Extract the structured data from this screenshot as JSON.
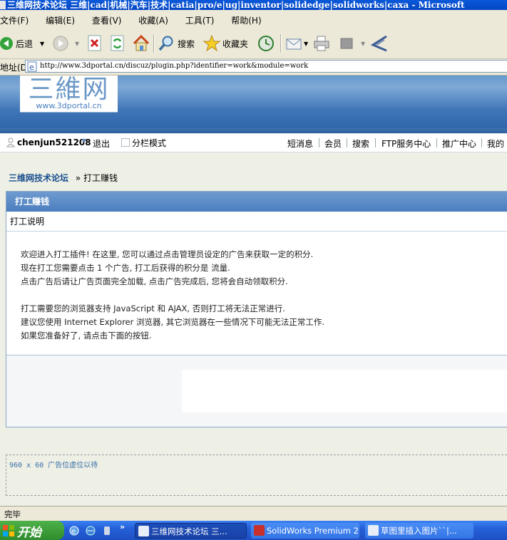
{
  "window": {
    "title": "三维网技术论坛 三维|cad|机械|汽车|技术|catia|pro/e|ug|inventor|solidedge|solidworks|caxa - Microsoft"
  },
  "menu": [
    "文件(F)",
    "编辑(E)",
    "查看(V)",
    "收藏(A)",
    "工具(T)",
    "帮助(H)"
  ],
  "toolbar": {
    "back": "后退",
    "search": "搜索",
    "favorites": "收藏夹"
  },
  "address": {
    "label": "地址(D)",
    "url": "http://www.3dportal.cn/discuz/plugin.php?identifier=work&module=work"
  },
  "logo": {
    "main": "三維网",
    "sub": "www.3dportal.cn"
  },
  "userbar": {
    "username": "chenjun521208",
    "logout": "退出",
    "split_mode": "分栏模式",
    "nav": [
      "短消息",
      "会员",
      "搜索",
      "FTP服务中心",
      "推广中心",
      "我的"
    ]
  },
  "breadcrumb": {
    "home": "三维网技术论坛",
    "sep": "»",
    "current": "打工赚钱"
  },
  "panel": {
    "title": "打工赚钱",
    "subtitle": "打工说明",
    "lines": [
      "欢迎进入打工插件! 在这里, 您可以通过点击管理员设定的广告来获取一定的积分.",
      "现在打工您需要点击  1 个广告, 打工后获得的积分是  流量.",
      "点击广告后请让广告页面完全加载, 点击广告完成后, 您将会自动领取积分.",
      "打工需要您的浏览器支持  JavaScript 和  AJAX, 否则打工将无法正常进行.",
      "建议您使用  Internet Explorer 浏览器, 其它浏览器在一些情况下可能无法正常工作.",
      "如果您准备好了, 请点击下面的按钮."
    ]
  },
  "ad_placeholder": "960 x 60 广告位虚位以待",
  "status": "完毕",
  "taskbar": {
    "start": "开始",
    "tasks": [
      "三维网技术论坛 三...",
      "SolidWorks Premium 2...",
      "草图里插入图片``|..."
    ]
  },
  "colors": {
    "accent": "#4c7fbf",
    "link": "#1a4f8e",
    "taskbar": "#2560d8"
  }
}
